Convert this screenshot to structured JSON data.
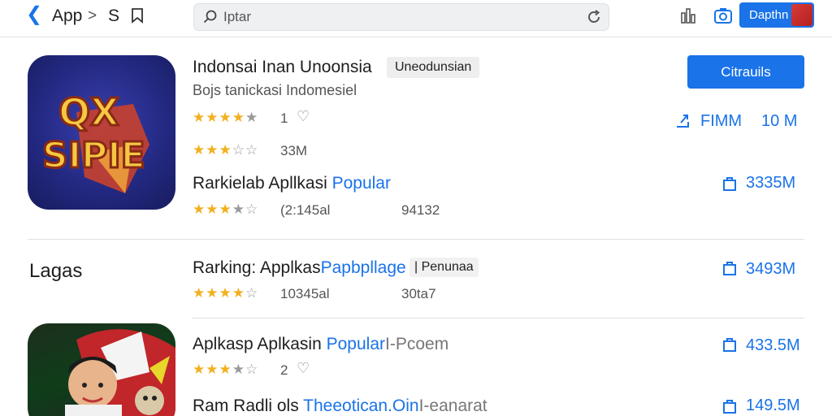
{
  "topbar": {
    "breadcrumb_app": "App",
    "breadcrumb_sep": ">",
    "breadcrumb_s": "S",
    "search_value": "Iptar",
    "button_label": "Dapthn"
  },
  "featured": {
    "icon_text_line1": "QX",
    "icon_text_line2": "SIPIE",
    "title": "Indonsai Inan Unoonsia",
    "tag": "Uneodunsian",
    "subtitle": "Bojs tanickasi Indomesiel",
    "rating_count": "1",
    "rating2_value": "33M",
    "primary_button": "Citrauils",
    "stat_label": "FIMM",
    "stat_value": "10 M"
  },
  "rows": [
    {
      "title_dark": "Rarkielab Apllkasi ",
      "title_blue": "Popular",
      "meta_1": "(2:145al",
      "meta_2": "94132",
      "size": "3335M"
    },
    {
      "title_dark": "Rarking: Applkas",
      "title_blue": "Papbpllage",
      "title_tag": "| Penunaa",
      "meta_1": "10345al",
      "meta_2": "30ta7",
      "size": "3493M"
    },
    {
      "title_dark": "Aplkasp Aplkasin ",
      "title_blue": "Popular",
      "title_gray": "I-Pcoem",
      "meta_1": "2",
      "size": "433.5M"
    },
    {
      "title_dark": "Ram Radli ols ",
      "title_blue": "Theeotican.Oin",
      "title_gray": "I-eanarat",
      "size": "149.5M"
    }
  ],
  "section": {
    "title": "Lagas"
  },
  "colors": {
    "accent": "#1a73e8",
    "star": "#f2b01e"
  }
}
